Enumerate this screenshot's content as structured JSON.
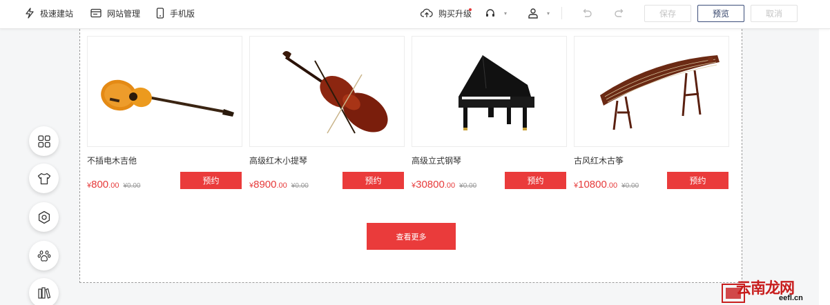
{
  "toolbar": {
    "quick_build": "极速建站",
    "site_manage": "网站管理",
    "mobile": "手机版",
    "upgrade": "购买升级",
    "save": "保存",
    "preview": "预览",
    "cancel": "取消"
  },
  "products": [
    {
      "name": "不插电木吉他",
      "price_int": "800",
      "price_dec": ".00",
      "orig_price": "¥0.00",
      "book": "预约"
    },
    {
      "name": "高级红木小提琴",
      "price_int": "8900",
      "price_dec": ".00",
      "orig_price": "¥0.00",
      "book": "预约"
    },
    {
      "name": "高级立式钢琴",
      "price_int": "30800",
      "price_dec": ".00",
      "orig_price": "¥0.00",
      "book": "预约"
    },
    {
      "name": "古风红木古筝",
      "price_int": "10800",
      "price_dec": ".00",
      "orig_price": "¥0.00",
      "book": "预约"
    }
  ],
  "currency": "¥",
  "more_button": "查看更多",
  "watermark": {
    "text": "云南龙网",
    "sub": "eefl.cn"
  },
  "colors": {
    "accent": "#ea3b3b",
    "preview_border": "#3a4c78"
  },
  "side_tools": [
    "grid-icon",
    "shirt-icon",
    "settings-icon",
    "paw-icon",
    "book-icon"
  ]
}
